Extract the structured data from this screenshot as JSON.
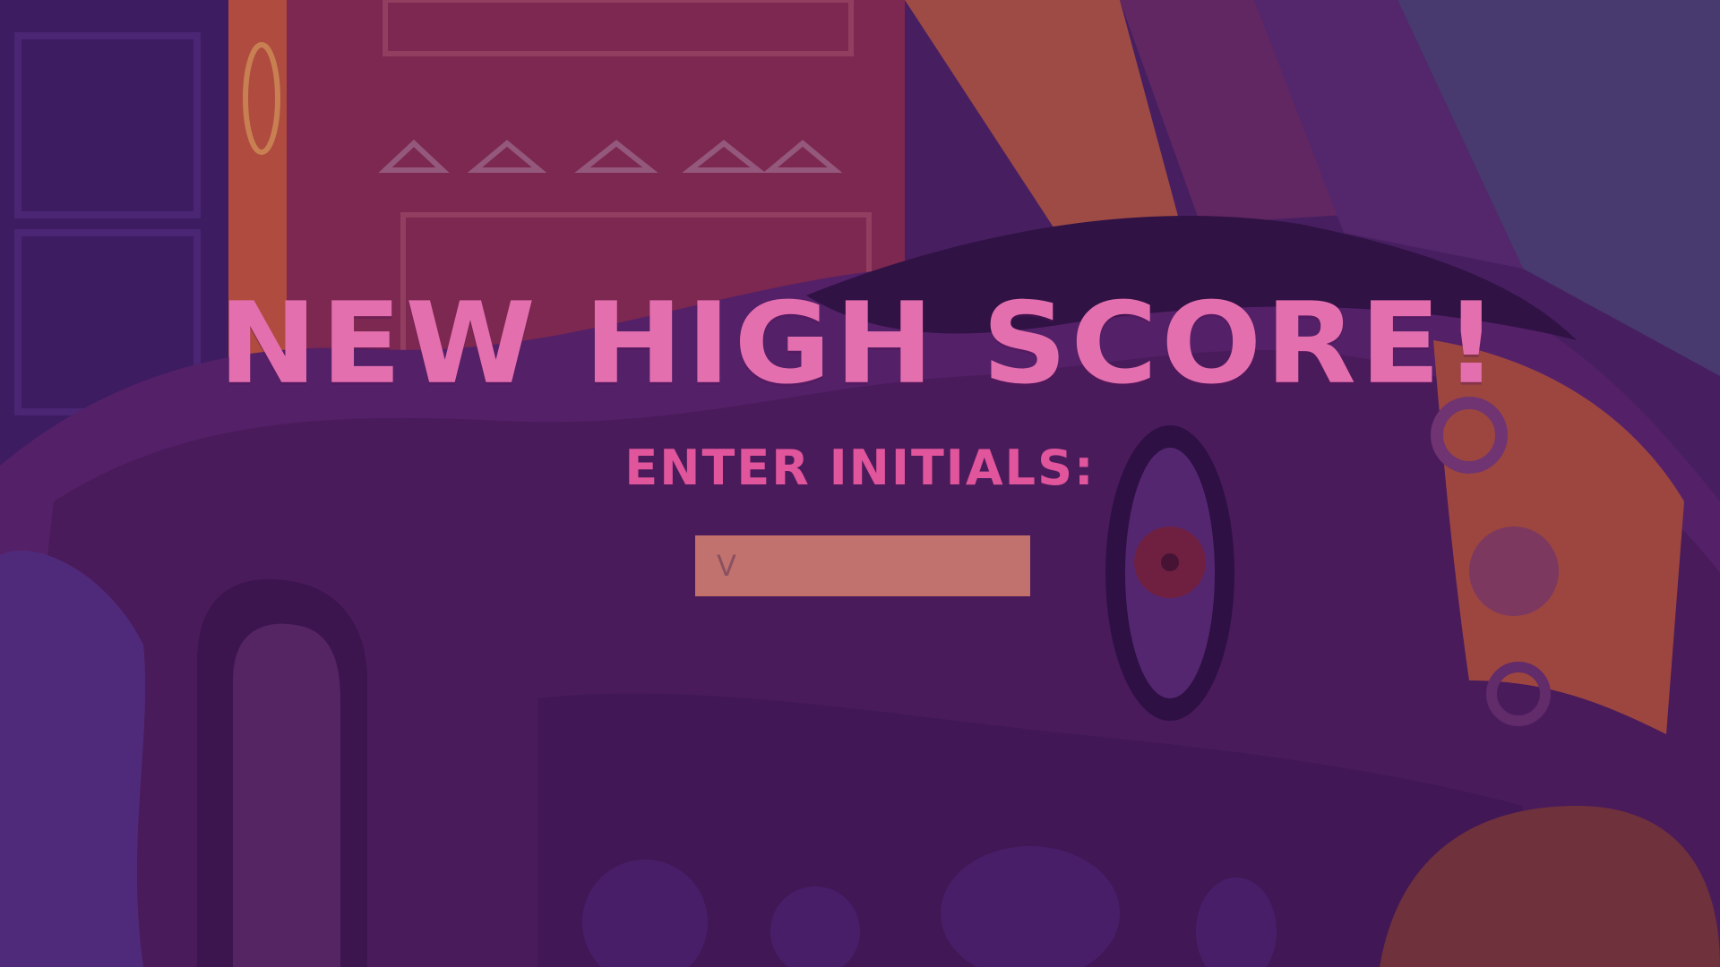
{
  "screen": {
    "title": "NEW HIGH SCORE!",
    "prompt": "ENTER INITIALS:"
  },
  "initials_input": {
    "value": "V"
  },
  "colors": {
    "title": "#e46fae",
    "prompt": "#e0559b",
    "input_background": "#c1726e"
  }
}
